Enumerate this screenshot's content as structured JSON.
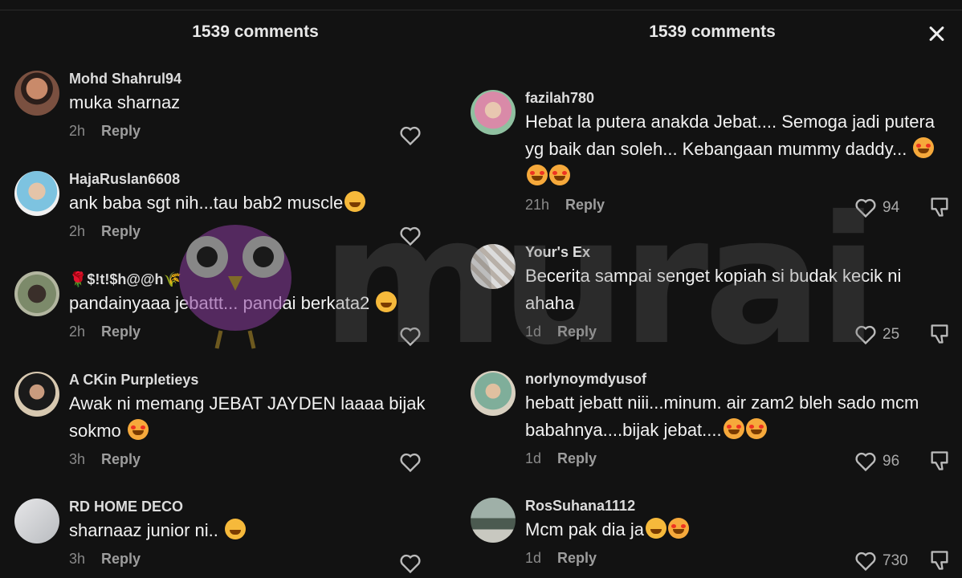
{
  "header": {
    "left_title": "1539 comments",
    "right_title": "1539 comments"
  },
  "watermark": {
    "text": "murai"
  },
  "reply_label": "Reply",
  "left_comments": [
    {
      "user": "Mohd Shahrul94",
      "text": "muka sharnaz",
      "time": "2h"
    },
    {
      "user": "HajaRuslan6608",
      "text": "ank baba sgt nih...tau bab2 muscle",
      "time": "2h"
    },
    {
      "user": "🌹$!t!$h@@h🌾",
      "text": "pandainyaaa jebattt... pandai berkata2",
      "time": "2h"
    },
    {
      "user": "A CKin Purpletieys",
      "text": "Awak ni memang JEBAT JAYDEN laaaa bijak sokmo",
      "time": "3h"
    },
    {
      "user": "RD HOME DECO",
      "text": "sharnaaz junior ni..",
      "time": "3h"
    }
  ],
  "right_comments": [
    {
      "user": "fazilah780",
      "text": "Hebat la putera anakda Jebat.... Semoga jadi putera yg baik dan soleh... Kebangaan mummy daddy...",
      "time": "21h",
      "likes": "94"
    },
    {
      "user": "Your's Ex",
      "text": "Becerita sampai senget kopiah si budak kecik ni ahaha",
      "time": "1d",
      "likes": "25"
    },
    {
      "user": "norlynoymdyusof",
      "text": "hebatt jebatt niii...minum. air zam2 bleh sado mcm babahnya....bijak jebat....",
      "time": "1d",
      "likes": "96"
    },
    {
      "user": "RosSuhana1112",
      "text": "Mcm pak dia ja",
      "time": "1d",
      "likes": "730"
    }
  ],
  "colors": {
    "background": "#121212",
    "text": "#f1f1f1",
    "muted": "#8a8a8a"
  },
  "icons": [
    "heart-icon",
    "dislike-icon",
    "close-icon"
  ]
}
